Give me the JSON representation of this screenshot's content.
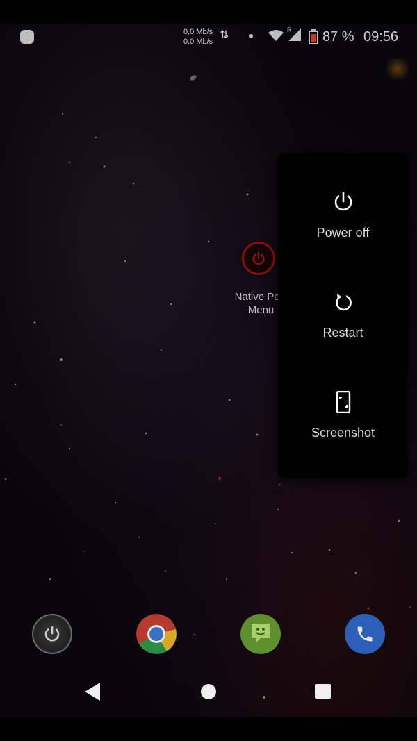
{
  "status_bar": {
    "net_up": "0,0 Mb/s",
    "net_down": "0,0 Mb/s",
    "roaming": "R",
    "battery_percent": "87 %",
    "time": "09:56",
    "icons": [
      "notification-icon",
      "data-arrows-icon",
      "wifi-icon",
      "signal-icon",
      "battery-icon"
    ]
  },
  "desktop": {
    "app_label": "Native Pow\nMenu"
  },
  "power_menu": {
    "items": [
      {
        "label": "Power off",
        "icon": "power-icon"
      },
      {
        "label": "Restart",
        "icon": "restart-icon"
      },
      {
        "label": "Screenshot",
        "icon": "screenshot-icon"
      }
    ]
  },
  "dock": {
    "apps": [
      "power-app-icon",
      "chrome-icon",
      "hangouts-icon",
      "phone-icon"
    ]
  },
  "navbar": {
    "buttons": [
      "back-button",
      "home-button",
      "recents-button"
    ]
  },
  "colors": {
    "panel_bg": "#000000",
    "label_text": "#dedede",
    "accent_red": "#8a0e0e"
  }
}
